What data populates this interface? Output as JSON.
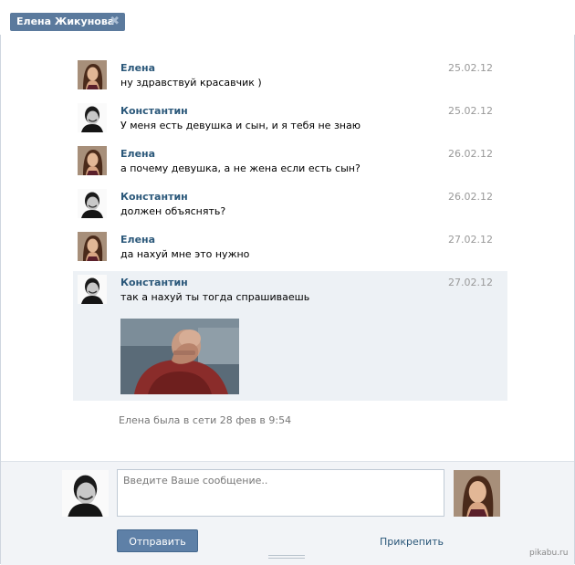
{
  "tab": {
    "title": "Елена Жикунова",
    "close_glyph": "✖"
  },
  "messages": [
    {
      "author": "Елена",
      "date": "25.02.12",
      "text": "ну здравствуй красавчик )",
      "avatar": "female-avatar"
    },
    {
      "author": "Константин",
      "date": "25.02.12",
      "text": "У меня есть девушка и сын, и я тебя не знаю",
      "avatar": "male-avatar"
    },
    {
      "author": "Елена",
      "date": "26.02.12",
      "text": "а почему девушка, а не жена если есть сын?",
      "avatar": "female-avatar"
    },
    {
      "author": "Константин",
      "date": "26.02.12",
      "text": "должен объяснять?",
      "avatar": "male-avatar"
    },
    {
      "author": "Елена",
      "date": "27.02.12",
      "text": "да нахуй мне это нужно",
      "avatar": "female-avatar"
    },
    {
      "author": "Константин",
      "date": "27.02.12",
      "text": "так а нахуй ты тогда спрашиваешь",
      "avatar": "male-avatar",
      "attachment": "facepalm-photo"
    }
  ],
  "status": "Елена была в сети 28 фев в 9:54",
  "composer": {
    "placeholder": "Введите Ваше сообщение..",
    "value": "",
    "send_label": "Отправить",
    "attach_label": "Прикрепить"
  },
  "watermark": "pikabu.ru",
  "colors": {
    "author_link": "#2b587a",
    "tab_bg": "#5b7a9d",
    "button_bg": "#5e80a7",
    "highlight_bg": "#edf1f5",
    "composer_bg": "#f2f4f7"
  }
}
